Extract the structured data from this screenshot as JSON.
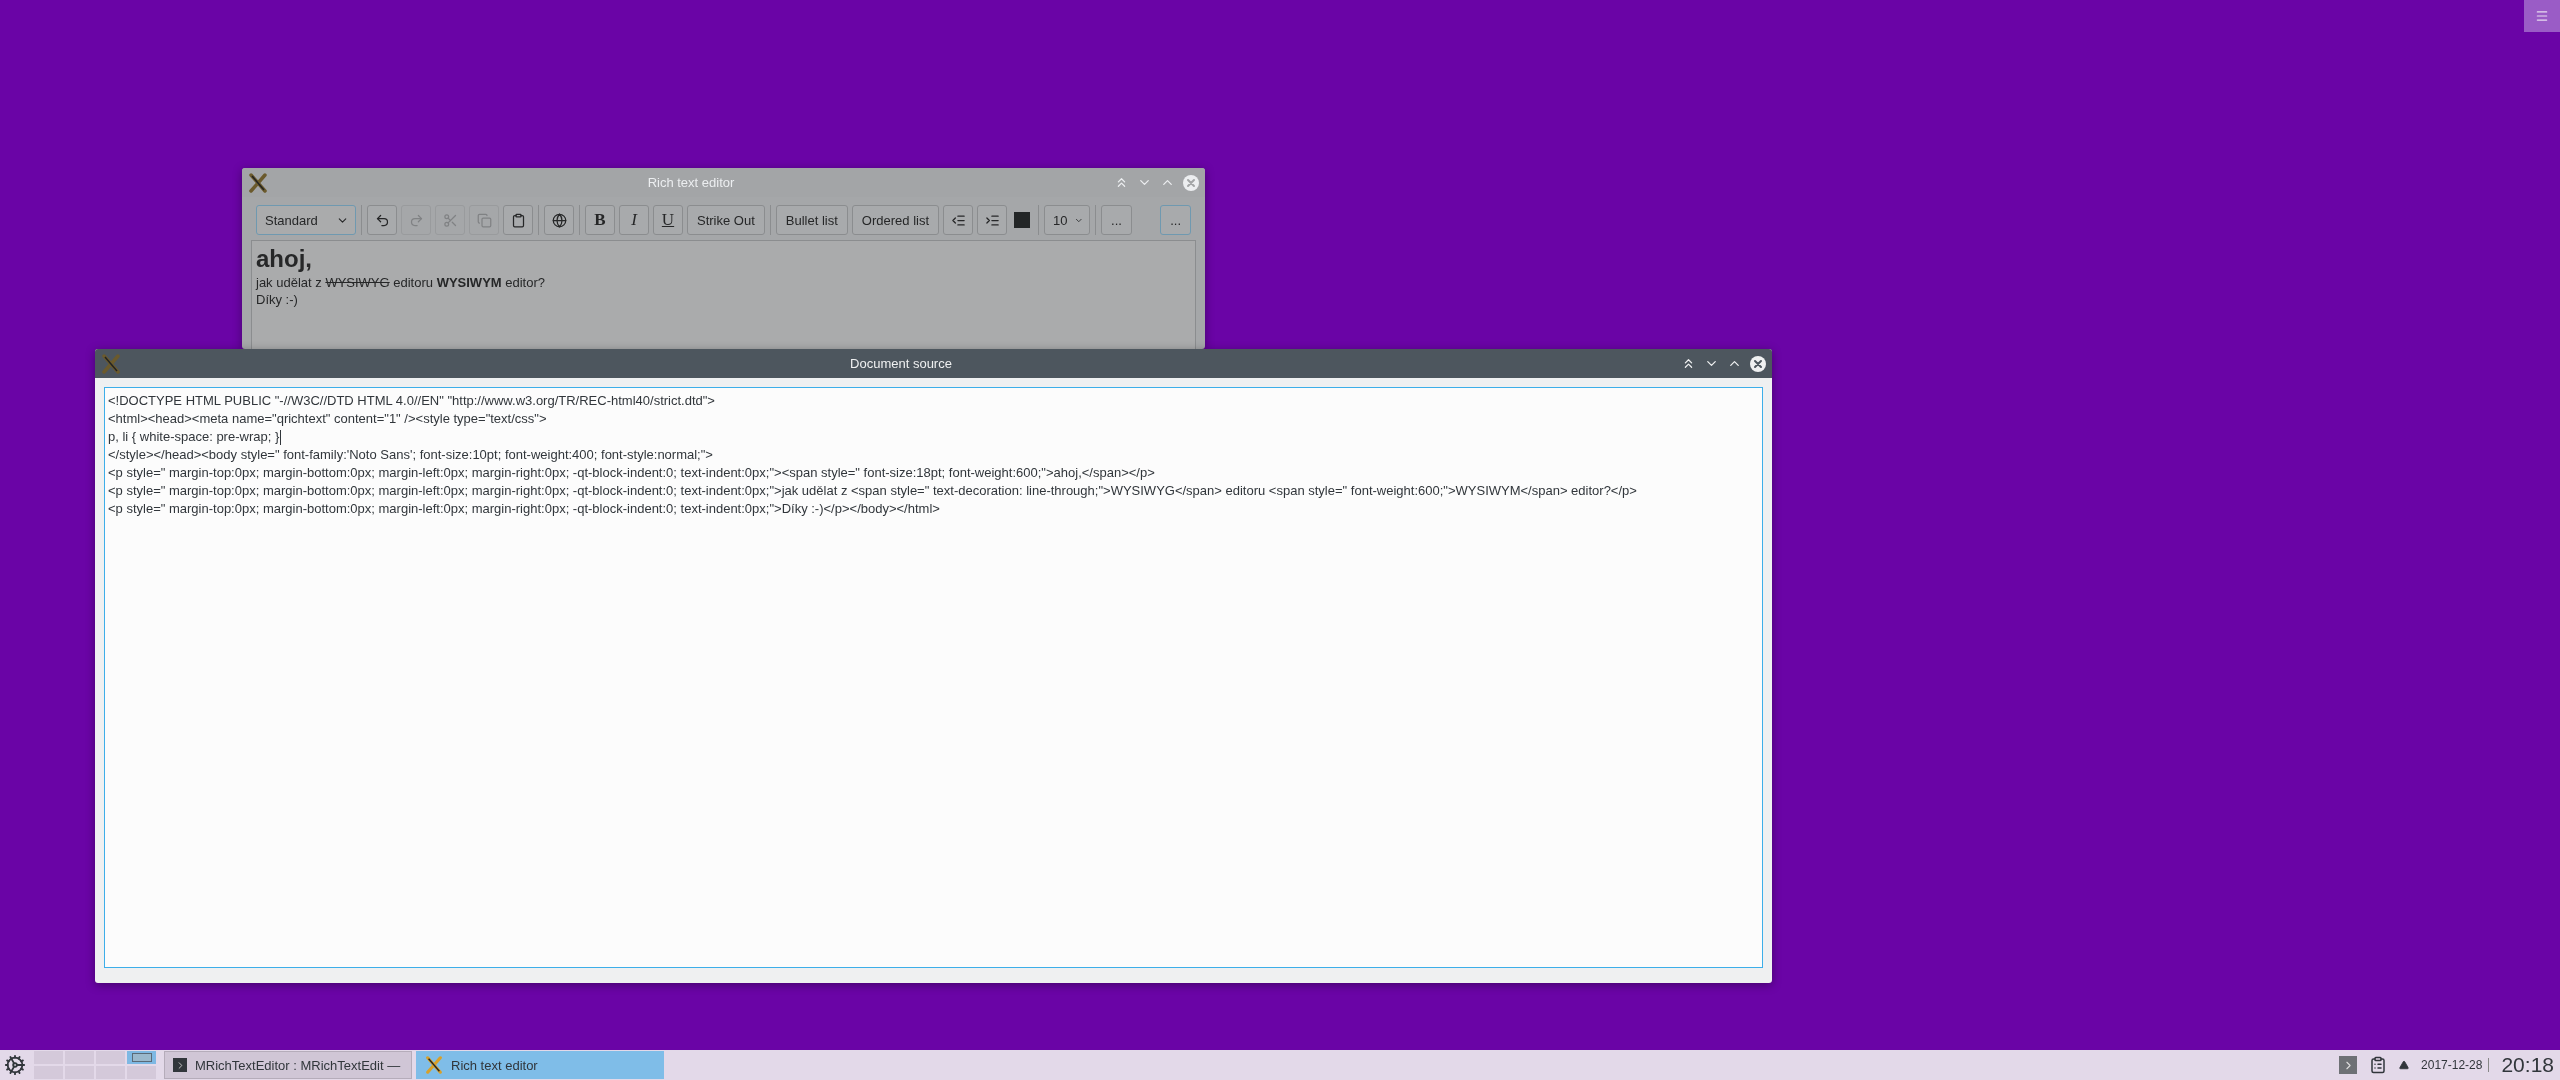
{
  "editor_window": {
    "title": "Rich text editor",
    "active": false,
    "toolbar": [
      [
        {
          "kind": "combo",
          "label": "Standard",
          "disabled": false
        }
      ],
      [
        {
          "kind": "undo",
          "disabled": false
        },
        {
          "kind": "redo",
          "disabled": true
        },
        {
          "kind": "cut",
          "disabled": true
        },
        {
          "kind": "copy",
          "disabled": true
        },
        {
          "kind": "paste",
          "disabled": false
        }
      ],
      [
        {
          "kind": "link",
          "disabled": false
        }
      ],
      [
        {
          "kind": "bold",
          "label": "B",
          "disabled": false
        },
        {
          "kind": "italic",
          "label": "I",
          "disabled": false
        },
        {
          "kind": "underline",
          "label": "U",
          "disabled": false
        },
        {
          "kind": "text",
          "label": "Strike Out",
          "disabled": false
        }
      ],
      [
        {
          "kind": "text",
          "label": "Bullet list",
          "disabled": false
        },
        {
          "kind": "text",
          "label": "Ordered list",
          "disabled": false
        },
        {
          "kind": "outdent",
          "disabled": false
        },
        {
          "kind": "indent",
          "disabled": false
        },
        {
          "kind": "color",
          "color": "#232627"
        }
      ],
      [
        {
          "kind": "combo",
          "label": "10",
          "disabled": false
        }
      ],
      [
        {
          "kind": "text",
          "label": "...",
          "disabled": false
        }
      ],
      [
        {
          "kind": "text",
          "label": "...",
          "disabled": false,
          "focused": true
        }
      ]
    ],
    "heading": "ahoj,",
    "lines": [
      [
        {
          "kind": "plain",
          "text": "jak udělat z "
        },
        {
          "kind": "strike",
          "text": "WYSIWYG"
        },
        {
          "kind": "plain",
          "text": " editoru "
        },
        {
          "kind": "bold",
          "text": "WYSIWYM"
        },
        {
          "kind": "plain",
          "text": " editor?"
        }
      ],
      [
        {
          "kind": "plain",
          "text": "Díky :-)"
        }
      ]
    ]
  },
  "source_window": {
    "title": "Document source",
    "active": true,
    "lines": [
      {
        "text": "<!DOCTYPE HTML PUBLIC \"-//W3C//DTD HTML 4.0//EN\" \"http://www.w3.org/TR/REC-html40/strict.dtd\">",
        "caret": false
      },
      {
        "text": "<html><head><meta name=\"qrichtext\" content=\"1\" /><style type=\"text/css\">",
        "caret": false
      },
      {
        "text": "p, li { white-space: pre-wrap; }",
        "caret": true
      },
      {
        "text": "</style></head><body style=\" font-family:'Noto Sans'; font-size:10pt; font-weight:400; font-style:normal;\">",
        "caret": false
      },
      {
        "text": "<p style=\" margin-top:0px; margin-bottom:0px; margin-left:0px; margin-right:0px; -qt-block-indent:0; text-indent:0px;\"><span style=\" font-size:18pt; font-weight:600;\">ahoj,</span></p>",
        "caret": false
      },
      {
        "text": "<p style=\" margin-top:0px; margin-bottom:0px; margin-left:0px; margin-right:0px; -qt-block-indent:0; text-indent:0px;\">jak udělat z <span style=\" text-decoration: line-through;\">WYSIWYG</span> editoru <span style=\" font-weight:600;\">WYSIWYM</span> editor?</p>",
        "caret": false
      },
      {
        "text": "<p style=\" margin-top:0px; margin-bottom:0px; margin-left:0px; margin-right:0px; -qt-block-indent:0; text-indent:0px;\">Díky :-)</p></body></html>",
        "caret": false
      }
    ]
  },
  "taskbar": {
    "pager": [
      {
        "selected": false
      },
      {
        "selected": false
      },
      {
        "selected": false
      },
      {
        "selected": true
      },
      {
        "selected": false
      },
      {
        "selected": false
      },
      {
        "selected": false
      },
      {
        "selected": false
      }
    ],
    "tasks": [
      {
        "kind": "terminal",
        "label": "MRichTextEditor : MRichTextEdit —",
        "selected": false
      },
      {
        "kind": "editor",
        "label": "Rich text editor",
        "selected": true
      }
    ],
    "date": "2017-12-28",
    "time": "20:18"
  }
}
